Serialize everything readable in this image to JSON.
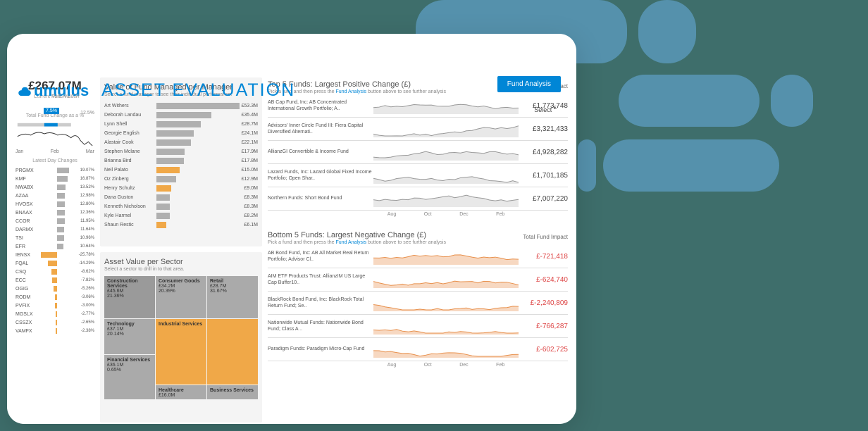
{
  "header": {
    "logo_text": "umulus",
    "logo_sub": "WEALTH",
    "title": "ASSET EVALUATION",
    "fund_analysis_btn": "Fund Analysis",
    "select_label": "Select",
    "currency": "£"
  },
  "left": {
    "fund_value": "£267.07M",
    "fund_value_label": "Current Fund Value",
    "change_badge": "7.5%",
    "change_secondary": "12.5%",
    "change_label": "Total Fund Change as a %",
    "months": [
      "Jan",
      "Feb",
      "Mar"
    ],
    "day_changes_label": "Latest Day Changes",
    "changes": [
      {
        "t": "PRGMX",
        "v": "19.07%",
        "p": 19.07
      },
      {
        "t": "KMF",
        "v": "16.87%",
        "p": 16.87
      },
      {
        "t": "NWABX",
        "v": "13.52%",
        "p": 13.52
      },
      {
        "t": "AZAA",
        "v": "12.98%",
        "p": 12.98
      },
      {
        "t": "HVOSX",
        "v": "12.80%",
        "p": 12.8
      },
      {
        "t": "BNAAX",
        "v": "12.36%",
        "p": 12.36
      },
      {
        "t": "CCOR",
        "v": "11.95%",
        "p": 11.95
      },
      {
        "t": "DARMX",
        "v": "11.64%",
        "p": 11.64
      },
      {
        "t": "TSI",
        "v": "10.96%",
        "p": 10.96
      },
      {
        "t": "EFR",
        "v": "10.64%",
        "p": 10.64
      },
      {
        "t": "IENSX",
        "v": "-25.78%",
        "p": -25.78
      },
      {
        "t": "FQAL",
        "v": "-14.29%",
        "p": -14.29
      },
      {
        "t": "CSQ",
        "v": "-8.62%",
        "p": -8.62
      },
      {
        "t": "ECC",
        "v": "-7.82%",
        "p": -7.82
      },
      {
        "t": "OGIG",
        "v": "-5.26%",
        "p": -5.26
      },
      {
        "t": "RODM",
        "v": "-3.06%",
        "p": -3.06
      },
      {
        "t": "PVFIX",
        "v": "-3.00%",
        "p": -3.0
      },
      {
        "t": "MGSLX",
        "v": "-2.77%",
        "p": -2.77
      },
      {
        "t": "CSSZX",
        "v": "-2.65%",
        "p": -2.65
      },
      {
        "t": "VAMFX",
        "v": "-2.38%",
        "p": -2.38
      }
    ]
  },
  "managers": {
    "title": "Value of Fund Managed per Manager",
    "sub": "Select a fund manager to see their individual performance.",
    "max": 53.3,
    "rows": [
      {
        "n": "Art Withers",
        "v": "£53.3M",
        "val": 53.3,
        "hl": false
      },
      {
        "n": "Deborah Landau",
        "v": "£35.4M",
        "val": 35.4,
        "hl": false
      },
      {
        "n": "Lynn Shell",
        "v": "£28.7M",
        "val": 28.7,
        "hl": false
      },
      {
        "n": "Georgie English",
        "v": "£24.1M",
        "val": 24.1,
        "hl": false
      },
      {
        "n": "Alastair Cook",
        "v": "£22.1M",
        "val": 22.1,
        "hl": false
      },
      {
        "n": "Stephen Mclane",
        "v": "£17.9M",
        "val": 17.9,
        "hl": false
      },
      {
        "n": "Brianna Bird",
        "v": "£17.8M",
        "val": 17.8,
        "hl": false
      },
      {
        "n": "Neil Palato",
        "v": "£15.0M",
        "val": 15.0,
        "hl": true
      },
      {
        "n": "Oz Zinberg",
        "v": "£12.9M",
        "val": 12.9,
        "hl": false
      },
      {
        "n": "Henry Schultz",
        "v": "£9.0M",
        "val": 9.0,
        "hl": true
      },
      {
        "n": "Dana Guston",
        "v": "£8.3M",
        "val": 8.3,
        "hl": false
      },
      {
        "n": "Kenneth Nicholson",
        "v": "£8.3M",
        "val": 8.3,
        "hl": false
      },
      {
        "n": "Kyle Harmel",
        "v": "£8.2M",
        "val": 8.2,
        "hl": false
      },
      {
        "n": "Shaun Restic",
        "v": "£6.1M",
        "val": 6.1,
        "hl": true
      }
    ]
  },
  "sectors": {
    "title": "Asset Value per Sector",
    "sub": "Select a sector to drill in to that area.",
    "cells": [
      {
        "name": "Construction Services",
        "v": "£45.6M",
        "pct": "21.36%"
      },
      {
        "name": "Consumer Goods",
        "v": "£34.2M",
        "pct": "20.39%"
      },
      {
        "name": "Retail",
        "v": "£28.7M",
        "pct": "31.67%"
      },
      {
        "name": "Technology",
        "v": "£37.1M",
        "pct": "20.14%"
      },
      {
        "name": "Industrial Services",
        "v": "",
        "pct": ""
      },
      {
        "name": "Financial Services",
        "v": "£36.1M",
        "pct": "0.65%"
      },
      {
        "name": "Healthcare",
        "v": "£16.0M",
        "pct": ""
      },
      {
        "name": "Business Services",
        "v": "",
        "pct": ""
      }
    ]
  },
  "top_funds": {
    "title": "Top 5 Funds: Largest Positive Change (£)",
    "sub_pre": "Pick a fund and then press the",
    "sub_link": "Fund Analysis",
    "sub_post": "button above to see further analysis",
    "impact_label": "Total Fund Impact",
    "rows": [
      {
        "n": "AB Cap Fund, Inc: AB Concentrated International Growth Portfolio; A..",
        "v": "£1,773,748"
      },
      {
        "n": "Advisors' Inner Circle Fund III: Fiera Capital Diversified Alternati..",
        "v": "£3,321,433"
      },
      {
        "n": "AllianzGI Convertible & Income Fund",
        "v": "£4,928,282"
      },
      {
        "n": "Lazard Funds, Inc: Lazard Global Fixed Income Portfolio; Open Shar..",
        "v": "£1,701,185"
      },
      {
        "n": "Northern Funds: Short Bond Fund",
        "v": "£7,007,220"
      }
    ],
    "timeline": [
      "Aug",
      "Oct",
      "Dec",
      "Feb"
    ]
  },
  "bottom_funds": {
    "title": "Bottom 5 Funds: Largest Negative Change (£)",
    "sub_pre": "Pick a fund and then press  the",
    "sub_link": "Fund Analysis",
    "sub_post": "button  above to see further analysis",
    "impact_label": "Total Fund Impact",
    "rows": [
      {
        "n": "AB Bond Fund, Inc: AB All Market Real Return Portfolio; Advisor Cl..",
        "v": "£-721,418"
      },
      {
        "n": "AIM ETF Products Trust: AllianzIM US Large Cap Buffer10..",
        "v": "£-624,740"
      },
      {
        "n": "BlackRock Bond Fund, Inc: BlackRock Total Return Fund; Se..",
        "v": "£-2,240,809"
      },
      {
        "n": "Nationwide Mutual Funds: Nationwide Bond Fund; Class A ..",
        "v": "£-766,287"
      },
      {
        "n": "Paradigm Funds: Paradigm Micro-Cap Fund",
        "v": "£-602,725"
      }
    ],
    "timeline": [
      "Aug",
      "Oct",
      "Dec",
      "Feb"
    ]
  },
  "chart_data": [
    {
      "type": "bar",
      "title": "Value of Fund Managed per Manager",
      "categories": [
        "Art Withers",
        "Deborah Landau",
        "Lynn Shell",
        "Georgie English",
        "Alastair Cook",
        "Stephen Mclane",
        "Brianna Bird",
        "Neil Palato",
        "Oz Zinberg",
        "Henry Schultz",
        "Dana Guston",
        "Kenneth Nicholson",
        "Kyle Harmel",
        "Shaun Restic"
      ],
      "values": [
        53.3,
        35.4,
        28.7,
        24.1,
        22.1,
        17.9,
        17.8,
        15.0,
        12.9,
        9.0,
        8.3,
        8.3,
        8.2,
        6.1
      ],
      "ylabel": "£M"
    },
    {
      "type": "bar",
      "title": "Latest Day Changes",
      "categories": [
        "PRGMX",
        "KMF",
        "NWABX",
        "AZAA",
        "HVOSX",
        "BNAAX",
        "CCOR",
        "DARMX",
        "TSI",
        "EFR",
        "IENSX",
        "FQAL",
        "CSQ",
        "ECC",
        "OGIG",
        "RODM",
        "PVFIX",
        "MGSLX",
        "CSSZX",
        "VAMFX"
      ],
      "values": [
        19.07,
        16.87,
        13.52,
        12.98,
        12.8,
        12.36,
        11.95,
        11.64,
        10.96,
        10.64,
        -25.78,
        -14.29,
        -8.62,
        -7.82,
        -5.26,
        -3.06,
        -3.0,
        -2.77,
        -2.65,
        -2.38
      ],
      "ylabel": "%"
    }
  ]
}
